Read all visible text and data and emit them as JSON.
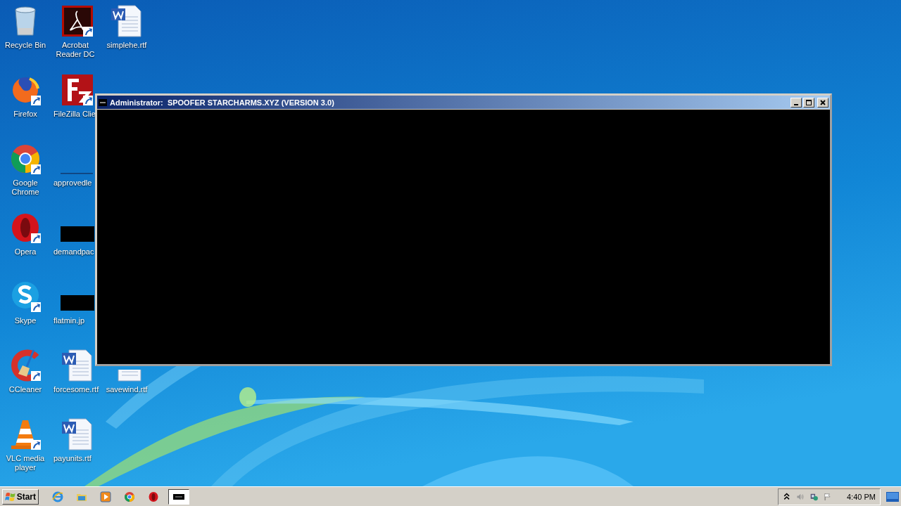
{
  "desktop": {
    "icons": [
      {
        "label": "Recycle Bin",
        "kind": "recycle-bin"
      },
      {
        "label": "Firefox",
        "kind": "firefox"
      },
      {
        "label": "Google Chrome",
        "kind": "chrome"
      },
      {
        "label": "Opera",
        "kind": "opera"
      },
      {
        "label": "Skype",
        "kind": "skype"
      },
      {
        "label": "CCleaner",
        "kind": "ccleaner"
      },
      {
        "label": "VLC media player",
        "kind": "vlc"
      },
      {
        "label": "Acrobat Reader DC",
        "kind": "acrobat"
      },
      {
        "label": "FileZilla Clie",
        "kind": "filezilla"
      },
      {
        "label": "approvedle",
        "kind": "hidden"
      },
      {
        "label": "demandpac",
        "kind": "thumbnail"
      },
      {
        "label": "flatmin.jp",
        "kind": "thumbnail"
      },
      {
        "label": "forcesome.rtf",
        "kind": "word"
      },
      {
        "label": "payunits.rtf",
        "kind": "word"
      },
      {
        "label": "simplehe.rtf",
        "kind": "word"
      },
      {
        "label": "savewind.rtf",
        "kind": "word"
      }
    ]
  },
  "window": {
    "title": "Administrator:  SPOOFER STARCHARMS.XYZ (VERSION 3.0)"
  },
  "taskbar": {
    "start": "Start",
    "apps": [
      {
        "kind": "ie",
        "selected": false
      },
      {
        "kind": "folder",
        "selected": false
      },
      {
        "kind": "media",
        "selected": false
      },
      {
        "kind": "chrome",
        "selected": false
      },
      {
        "kind": "opera",
        "selected": false
      },
      {
        "kind": "console",
        "selected": true
      }
    ],
    "clock": "4:40 PM"
  }
}
